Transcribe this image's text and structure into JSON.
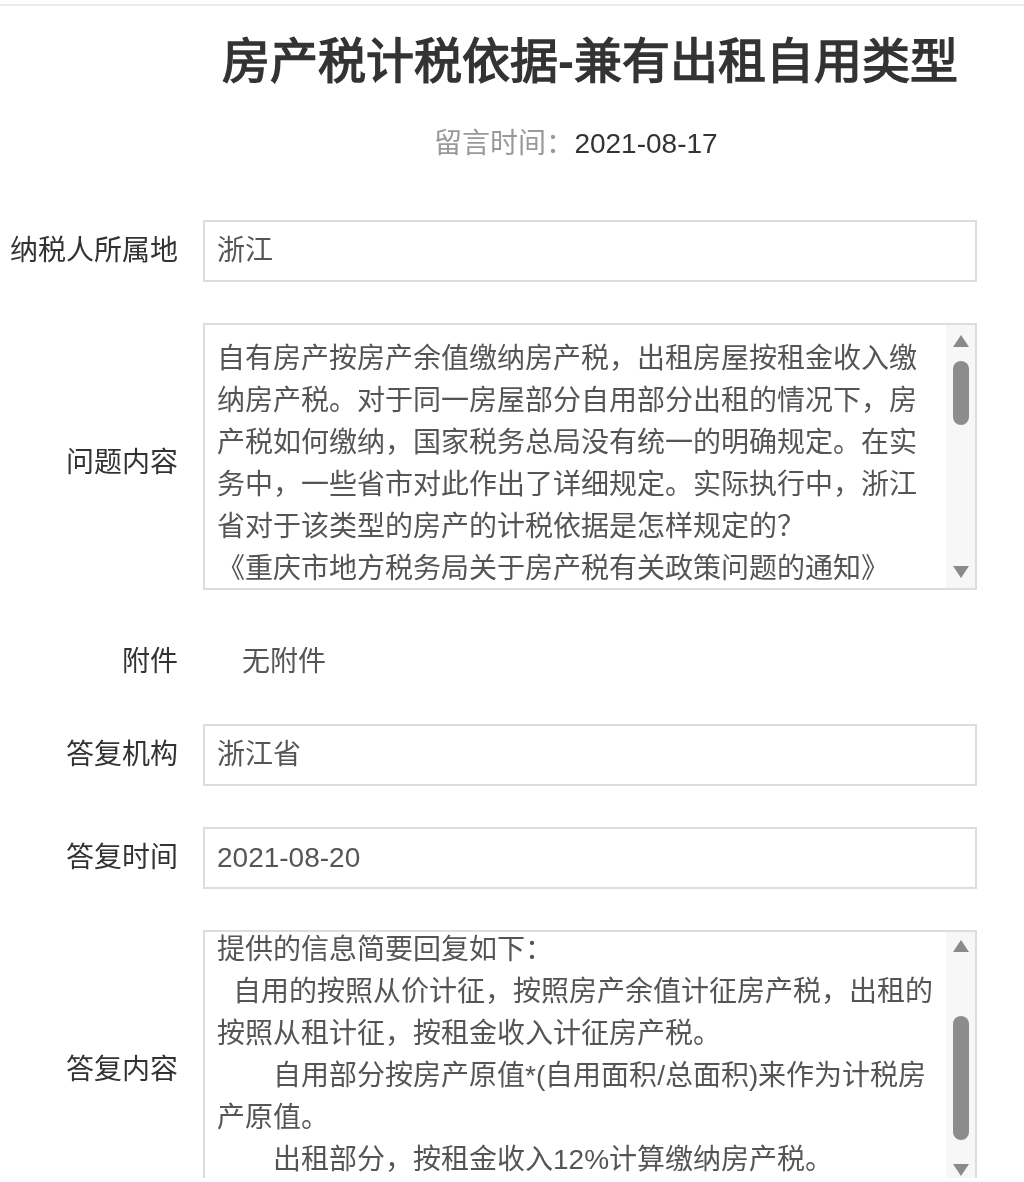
{
  "title": "房产税计税依据-兼有出租自用类型",
  "posted": {
    "label": "留言时间：",
    "value": "2021-08-17"
  },
  "fields": [
    {
      "kind": "input",
      "label": "纳税人所属地",
      "value": "浙江"
    },
    {
      "kind": "textarea",
      "label": "问题内容",
      "paragraphs": [
        "自有房产按房产余值缴纳房产税，出租房屋按租金收入缴纳房产税。对于同一房屋部分自用部分出租的情况下，房产税如何缴纳，国家税务总局没有统一的明确规定。在实务中，一些省市对此作出了详细规定。实际执行中，浙江省对于该类型的房产的计税依据是怎样规定的？",
        "《重庆市地方税务局关于房产税有关政策问题的通知》"
      ]
    },
    {
      "kind": "plain",
      "label": "附件",
      "value": "无附件"
    },
    {
      "kind": "input",
      "label": "答复机构",
      "value": "浙江省"
    },
    {
      "kind": "input",
      "label": "答复时间",
      "value": "2021-08-20"
    },
    {
      "kind": "textarea",
      "label": "答复内容",
      "paragraphs": [
        "提供的信息简要回复如下：",
        "  自用的按照从价计征，按照房产余值计征房产税，出租的按照从租计征，按租金收入计征房产税。",
        "　　自用部分按房产原值*(自用面积/总面积)来作为计税房产原值。",
        "　　出租部分，按租金收入12%计算缴纳房产税。"
      ]
    }
  ]
}
